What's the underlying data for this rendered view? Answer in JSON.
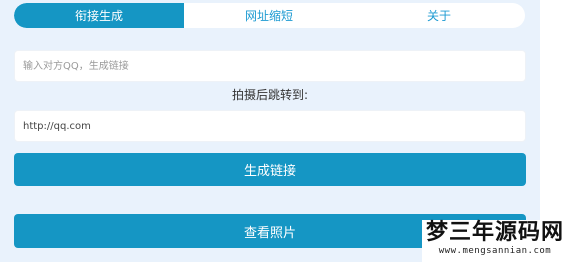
{
  "tabs": [
    {
      "label": "衔接生成",
      "active": true
    },
    {
      "label": "网址缩短",
      "active": false
    },
    {
      "label": "关于",
      "active": false
    }
  ],
  "qq_input": {
    "placeholder": "输入对方QQ，生成链接",
    "value": ""
  },
  "redirect_label": "拍摄后跳转到:",
  "url_input": {
    "value": "http://qq.com"
  },
  "generate_button": "生成链接",
  "view_button": "查看照片",
  "watermark": {
    "title": "梦三年源码网",
    "url": "www.mengsannian.com"
  },
  "colors": {
    "accent": "#1596c4",
    "background": "#e9f2fc",
    "tab_text": "#1e9bd2"
  }
}
